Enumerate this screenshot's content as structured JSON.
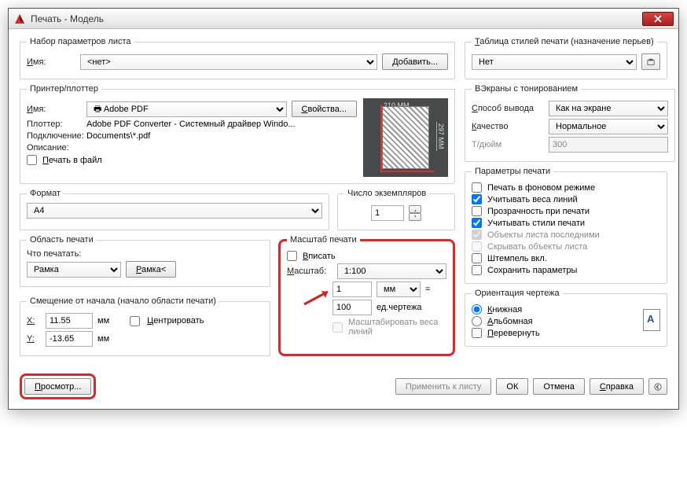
{
  "window": {
    "title": "Печать - Модель"
  },
  "pageSetup": {
    "legend": "Набор параметров листа",
    "name_label": "Имя:",
    "name_value": "<нет>",
    "add_btn": "Добавить..."
  },
  "plotStyle": {
    "legend": "Таблица стилей печати (назначение перьев)",
    "value": "Нет"
  },
  "printer": {
    "legend": "Принтер/плоттер",
    "name_label": "Имя:",
    "name_value": "Adobe PDF",
    "props_btn": "Свойства...",
    "plotter_label": "Плоттер:",
    "plotter_value": "Adobe PDF Converter - Системный драйвер Windo...",
    "conn_label": "Подключение:",
    "conn_value": "Documents\\*.pdf",
    "desc_label": "Описание:",
    "print_to_file": "Печать в файл",
    "preview_width": "210 MM",
    "preview_height": "297 MM"
  },
  "shaded": {
    "legend": "ВЭкраны с тонированием",
    "output_label": "Способ вывода",
    "output_value": "Как на экране",
    "quality_label": "Качество",
    "quality_value": "Нормальное",
    "dpi_label": "Т/дюйм",
    "dpi_value": "300"
  },
  "paper": {
    "legend": "Формат",
    "value": "A4"
  },
  "copies": {
    "legend": "Число экземпляров",
    "value": "1"
  },
  "options": {
    "legend": "Параметры печати",
    "bg": "Печать в фоновом режиме",
    "lineweights": "Учитывать веса линий",
    "transparency": "Прозрачность при печати",
    "styles": "Учитывать стили печати",
    "paperspace_last": "Объекты листа последними",
    "hide": "Скрывать объекты листа",
    "stamp": "Штемпель вкл.",
    "save": "Сохранить параметры"
  },
  "plotArea": {
    "legend": "Область печати",
    "what_label": "Что печатать:",
    "what_value": "Рамка",
    "window_btn": "Рамка<"
  },
  "scale": {
    "legend": "Масштаб печати",
    "fit": "Вписать",
    "scale_label": "Масштаб:",
    "scale_value": "1:100",
    "unit_value": "1",
    "unit_select": "мм",
    "equals": "=",
    "drawing_value": "100",
    "drawing_label": "ед.чертежа",
    "scale_lw": "Масштабировать веса линий"
  },
  "offset": {
    "legend": "Смещение от начала (начало области печати)",
    "x_label": "X:",
    "x_value": "11.55",
    "y_label": "Y:",
    "y_value": "-13.65",
    "unit": "мм",
    "center": "Центрировать"
  },
  "orient": {
    "legend": "Ориентация чертежа",
    "portrait": "Книжная",
    "landscape": "Альбомная",
    "upside": "Перевернуть"
  },
  "footer": {
    "preview": "Просмотр...",
    "apply": "Применить к листу",
    "ok": "ОК",
    "cancel": "Отмена",
    "help": "Справка"
  }
}
